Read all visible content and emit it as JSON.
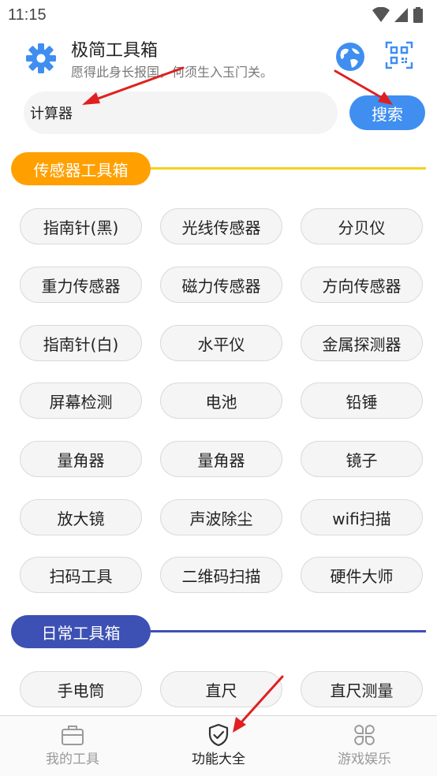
{
  "status": {
    "time": "11:15"
  },
  "header": {
    "title": "极简工具箱",
    "subtitle": "愿得此身长报国，何须生入玉门关。",
    "settings_icon": "gear-icon",
    "language_icon": "globe-icon",
    "scan_icon": "qr-scan-icon"
  },
  "search": {
    "value": "计算器",
    "placeholder": "",
    "button_label": "搜索"
  },
  "colors": {
    "accent_blue": "#3f8ef0",
    "sensor_orange": "#ffa000",
    "sensor_line": "#f5d21c",
    "daily_indigo": "#3d50b3",
    "arrow_red": "#e02020"
  },
  "sections": [
    {
      "title": "传感器工具箱",
      "tools": [
        "指南针(黑)",
        "光线传感器",
        "分贝仪",
        "重力传感器",
        "磁力传感器",
        "方向传感器",
        "指南针(白)",
        "水平仪",
        "金属探测器",
        "屏幕检测",
        "电池",
        "铅锤",
        "量角器",
        "量角器",
        "镜子",
        "放大镜",
        "声波除尘",
        "wifi扫描",
        "扫码工具",
        "二维码扫描",
        "硬件大师"
      ]
    },
    {
      "title": "日常工具箱",
      "tools": [
        "手电筒",
        "直尺",
        "直尺测量"
      ]
    }
  ],
  "nav": [
    {
      "label": "我的工具",
      "icon": "toolbox-icon",
      "active": false
    },
    {
      "label": "功能大全",
      "icon": "shield-check-icon",
      "active": true
    },
    {
      "label": "游戏娱乐",
      "icon": "clover-grid-icon",
      "active": false
    }
  ]
}
